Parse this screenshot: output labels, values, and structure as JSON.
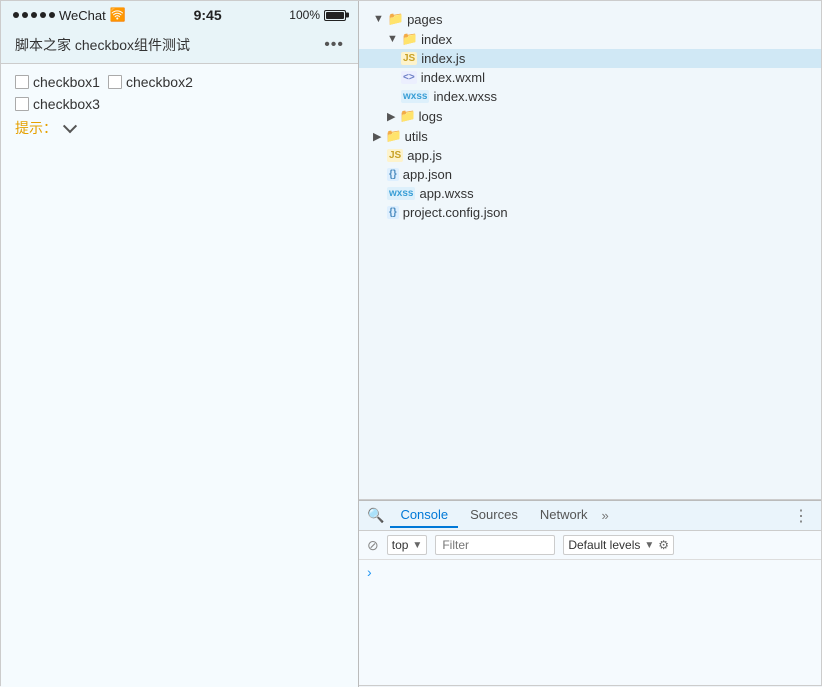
{
  "phone": {
    "status": {
      "dots": [
        "●",
        "●",
        "●",
        "●",
        "●"
      ],
      "app_name": "WeChat",
      "wifi": "📶",
      "time": "9:45",
      "battery_pct": "100%"
    },
    "header": {
      "title": "脚本之家 checkbox组件测试",
      "dots": "•••"
    },
    "checkboxes": [
      {
        "id": "cb1",
        "label": "checkbox1"
      },
      {
        "id": "cb2",
        "label": "checkbox2"
      },
      {
        "id": "cb3",
        "label": "checkbox3"
      }
    ],
    "hint_label": "提示："
  },
  "file_tree": {
    "items": [
      {
        "id": "pages",
        "label": "pages",
        "type": "folder",
        "indent": 1,
        "open": true,
        "arrow": "▼"
      },
      {
        "id": "index",
        "label": "index",
        "type": "folder",
        "indent": 2,
        "open": true,
        "arrow": "▼"
      },
      {
        "id": "index_js",
        "label": "index.js",
        "type": "js",
        "indent": 3,
        "active": true
      },
      {
        "id": "index_wxml",
        "label": "index.wxml",
        "type": "xml",
        "indent": 3
      },
      {
        "id": "index_wxss",
        "label": "index.wxss",
        "type": "wxss",
        "indent": 3
      },
      {
        "id": "logs",
        "label": "logs",
        "type": "folder",
        "indent": 2,
        "open": false,
        "arrow": "▶"
      },
      {
        "id": "utils",
        "label": "utils",
        "type": "folder",
        "indent": 1,
        "open": false,
        "arrow": "▶"
      },
      {
        "id": "app_js",
        "label": "app.js",
        "type": "js",
        "indent": 2
      },
      {
        "id": "app_json",
        "label": "app.json",
        "type": "json",
        "indent": 2
      },
      {
        "id": "app_wxss",
        "label": "app.wxss",
        "type": "wxss",
        "indent": 2
      },
      {
        "id": "project_config",
        "label": "project.config.json",
        "type": "json",
        "indent": 2
      }
    ]
  },
  "console": {
    "tabs": [
      {
        "label": "Console",
        "active": true
      },
      {
        "label": "Sources",
        "active": false
      },
      {
        "label": "Network",
        "active": false
      }
    ],
    "more_icon": "»",
    "no_entry_icon": "⊘",
    "top_label": "top",
    "filter_placeholder": "Filter",
    "default_levels_label": "Default levels",
    "prompt_arrow": "›"
  }
}
